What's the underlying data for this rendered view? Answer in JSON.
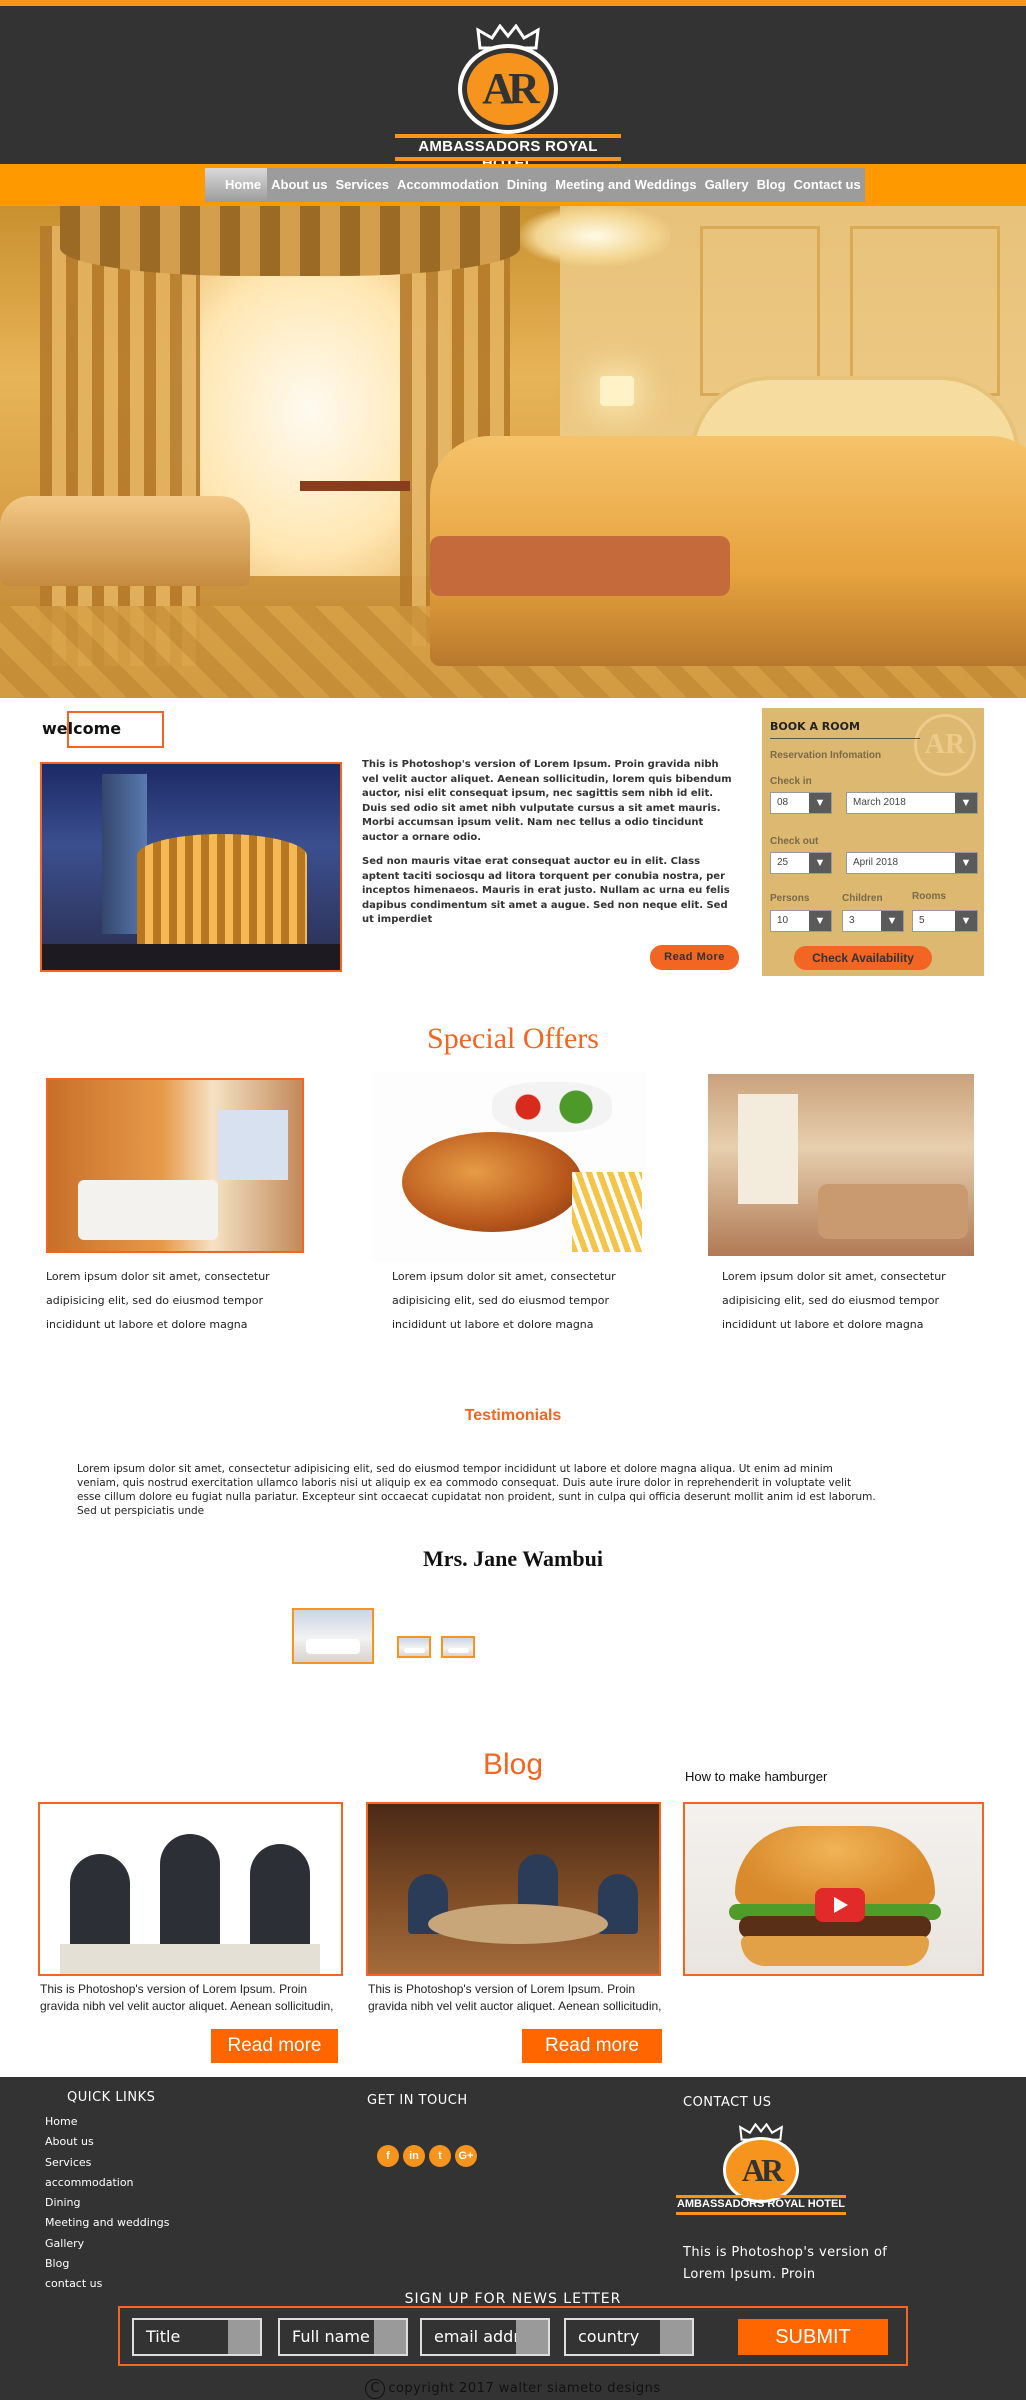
{
  "header": {
    "brand": "AMBASSADORS ROYAL HOTEL",
    "logo_letters": "AR"
  },
  "nav": {
    "items": [
      "Home",
      "About us",
      "Services",
      "Accommodation",
      "Dining",
      "Meeting and Weddings",
      "Gallery",
      "Blog",
      "Contact us"
    ],
    "active": "Home"
  },
  "welcome": {
    "title": "welcome",
    "para1": "This is Photoshop's version  of Lorem Ipsum. Proin gravida nibh vel velit auctor aliquet. Aenean sollicitudin, lorem quis bibendum auctor, nisi elit consequat ipsum, nec sagittis sem nibh id elit. Duis sed odio sit amet nibh vulputate cursus a sit amet mauris. Morbi accumsan ipsum velit. Nam nec tellus a odio tincidunt auctor a ornare odio.",
    "para2": "Sed non  mauris vitae erat consequat auctor eu in elit. Class aptent taciti sociosqu ad litora torquent per conubia nostra, per inceptos himenaeos. Mauris in erat justo. Nullam ac urna eu felis dapibus condimentum sit amet a augue. Sed non neque elit. Sed ut imperdiet",
    "read_more": "Read  More"
  },
  "booking": {
    "title": "BOOK A ROOM",
    "subtitle": "Reservation Infomation",
    "check_in_label": "Check in",
    "check_in_day": "08",
    "check_in_month": "March  2018",
    "check_out_label": "Check out",
    "check_out_day": "25",
    "check_out_month": "April  2018",
    "persons_label": "Persons",
    "persons": "10",
    "children_label": "Children",
    "children": "3",
    "rooms_label": "Rooms",
    "rooms": "5",
    "button": "Check Availability",
    "arrow_glyph": "▼"
  },
  "offers": {
    "title": "Special  Offers",
    "items": [
      {
        "text": "Lorem ipsum dolor sit amet, consectetur adipisicing elit, sed do eiusmod tempor incididunt ut labore et dolore magna"
      },
      {
        "text": "Lorem ipsum dolor sit amet, consectetur adipisicing elit, sed do eiusmod tempor incididunt ut labore et dolore magna"
      },
      {
        "text": "Lorem ipsum dolor sit amet, consectetur adipisicing elit, sed do eiusmod tempor incididunt ut labore et dolore magna"
      }
    ]
  },
  "testimonials": {
    "title": "Testimonials",
    "text": "Lorem ipsum dolor sit amet, consectetur adipisicing elit, sed do eiusmod tempor incididunt ut labore et dolore magna aliqua. Ut enim ad minim veniam, quis nostrud exercitation ullamco laboris nisi ut aliquip ex ea commodo consequat. Duis aute irure dolor in reprehenderit in voluptate velit esse cillum dolore eu fugiat nulla pariatur. Excepteur sint occaecat cupidatat non proident, sunt in culpa qui officia deserunt mollit anim id est laborum. Sed ut perspiciatis unde",
    "name": "Mrs. Jane Wambui"
  },
  "blog": {
    "title": "Blog",
    "video_title": "How to make hamburger",
    "posts": [
      {
        "text": "This is Photoshop's version  of Lorem Ipsum. Proin gravida nibh vel velit auctor aliquet. Aenean sollicitudin, lorem quis",
        "read_more": "Read more"
      },
      {
        "text": "This is Photoshop's version  of Lorem Ipsum. Proin gravida nibh vel velit auctor aliquet. Aenean sollicitudin, lorem quis",
        "read_more": "Read more"
      }
    ]
  },
  "footer": {
    "quick_links_title": "QUICK LINKS",
    "quick_links": [
      "Home",
      "About us",
      "Services",
      "accommodation",
      "Dining",
      "Meeting and weddings",
      "Gallery",
      "Blog",
      "contact us"
    ],
    "get_in_touch": "GET IN TOUCH",
    "social": [
      "f",
      "in",
      "t",
      "G+"
    ],
    "contact_title": "CONTACT US",
    "brand": "AMBASSADORS ROYAL HOTEL",
    "logo_letters": "AR",
    "about": "This is Photoshop's version of Lorem Ipsum. Proin",
    "newsletter_title": "SIGN UP FOR NEWS LETTER",
    "fields": {
      "title": "Title",
      "full_name": "Full name",
      "email": "email addr",
      "country": "country"
    },
    "submit": "SUBMIT",
    "copyright": "copyright 2017  walter siameto designs",
    "copyright_symbol": "C"
  },
  "colors": {
    "orange": "#f26522",
    "nav_orange": "#ff9900",
    "dark": "#333333",
    "booking_bg": "#ddb870"
  }
}
